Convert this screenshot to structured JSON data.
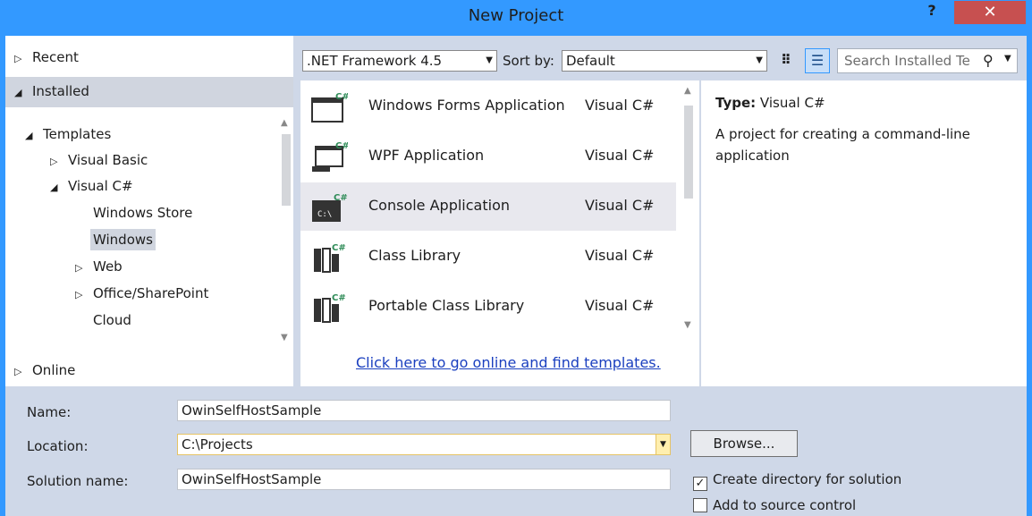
{
  "window": {
    "title": "New Project",
    "help": "?",
    "close": "✕"
  },
  "left": {
    "recent": "Recent",
    "installed": "Installed",
    "online": "Online",
    "tree": [
      {
        "label": "Templates",
        "arrow": "◢"
      },
      {
        "label": "Visual Basic",
        "arrow": "▷"
      },
      {
        "label": "Visual C#",
        "arrow": "◢"
      },
      {
        "label": "Windows Store",
        "arrow": ""
      },
      {
        "label": "Windows",
        "arrow": ""
      },
      {
        "label": "Web",
        "arrow": "▷"
      },
      {
        "label": "Office/SharePoint",
        "arrow": "▷"
      },
      {
        "label": "Cloud",
        "arrow": ""
      }
    ]
  },
  "toolbar": {
    "framework": ".NET Framework 4.5",
    "sort_label": "Sort by:",
    "sort_value": "Default",
    "search_placeholder": "Search Installed Te"
  },
  "templates": [
    {
      "name": "Windows Forms Application",
      "lang": "Visual C#"
    },
    {
      "name": "WPF Application",
      "lang": "Visual C#"
    },
    {
      "name": "Console Application",
      "lang": "Visual C#"
    },
    {
      "name": "Class Library",
      "lang": "Visual C#"
    },
    {
      "name": "Portable Class Library",
      "lang": "Visual C#"
    }
  ],
  "online_link": "Click here to go online and find templates.",
  "details": {
    "type_label": "Type:",
    "type_value": "Visual C#",
    "description": "A project for creating a command-line application"
  },
  "form": {
    "name_label": "Name:",
    "name_value": "OwinSelfHostSample",
    "location_label": "Location:",
    "location_value": "C:\\Projects",
    "solution_label": "Solution name:",
    "solution_value": "OwinSelfHostSample",
    "browse": "Browse...",
    "create_dir": "Create directory for solution",
    "add_source": "Add to source control"
  }
}
